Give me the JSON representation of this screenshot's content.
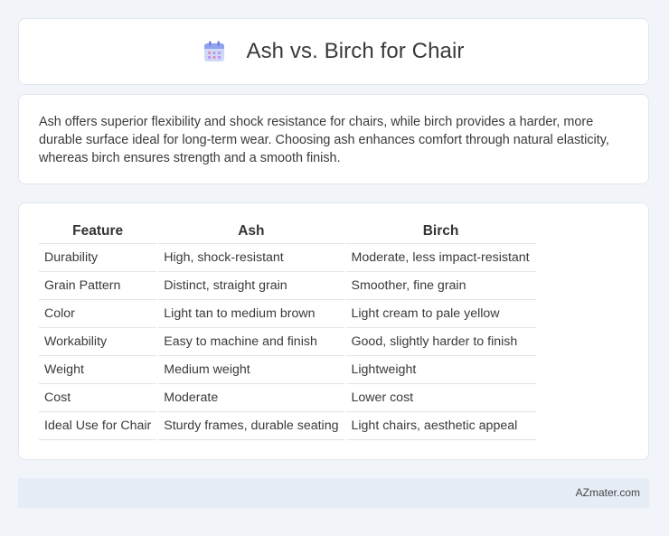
{
  "header": {
    "title": "Ash vs. Birch for Chair",
    "icon": "calendar-icon"
  },
  "summary": {
    "text": "Ash offers superior flexibility and shock resistance for chairs, while birch provides a harder, more durable surface ideal for long-term wear. Choosing ash enhances comfort through natural elasticity, whereas birch ensures strength and a smooth finish."
  },
  "table": {
    "headers": [
      "Feature",
      "Ash",
      "Birch"
    ],
    "rows": [
      [
        "Durability",
        "High, shock-resistant",
        "Moderate, less impact-resistant"
      ],
      [
        "Grain Pattern",
        "Distinct, straight grain",
        "Smoother, fine grain"
      ],
      [
        "Color",
        "Light tan to medium brown",
        "Light cream to pale yellow"
      ],
      [
        "Workability",
        "Easy to machine and finish",
        "Good, slightly harder to finish"
      ],
      [
        "Weight",
        "Medium weight",
        "Lightweight"
      ],
      [
        "Cost",
        "Moderate",
        "Lower cost"
      ],
      [
        "Ideal Use for Chair",
        "Sturdy frames, durable seating",
        "Light chairs, aesthetic appeal"
      ]
    ]
  },
  "footer": {
    "text": "AZmater.com"
  }
}
